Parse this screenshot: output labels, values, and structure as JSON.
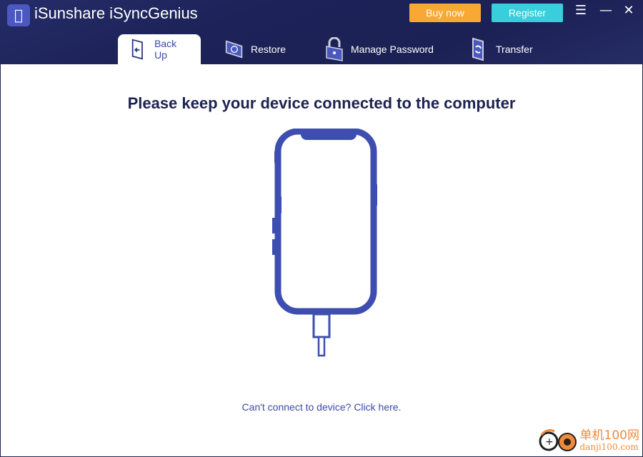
{
  "app": {
    "title": "iSunshare iSyncGenius"
  },
  "header": {
    "buy_now": "Buy now",
    "register": "Register",
    "menu_icon": "menu-icon",
    "minimize_icon": "minimize-icon",
    "close_icon": "close-icon"
  },
  "tabs": [
    {
      "label": "Back Up",
      "icon": "backup-icon",
      "active": true
    },
    {
      "label": "Restore",
      "icon": "restore-icon",
      "active": false
    },
    {
      "label": "Manage Password",
      "icon": "lock-icon",
      "active": false
    },
    {
      "label": "Transfer",
      "icon": "transfer-icon",
      "active": false
    }
  ],
  "main": {
    "headline": "Please keep your device connected to the computer",
    "help_link": "Can't connect to device? Click here."
  },
  "watermark": {
    "line1": "单机100网",
    "line2": "danji100.com"
  },
  "colors": {
    "header": "#1e2456",
    "accent": "#3d4eb0",
    "buy": "#f9a833",
    "register": "#38cedb"
  }
}
